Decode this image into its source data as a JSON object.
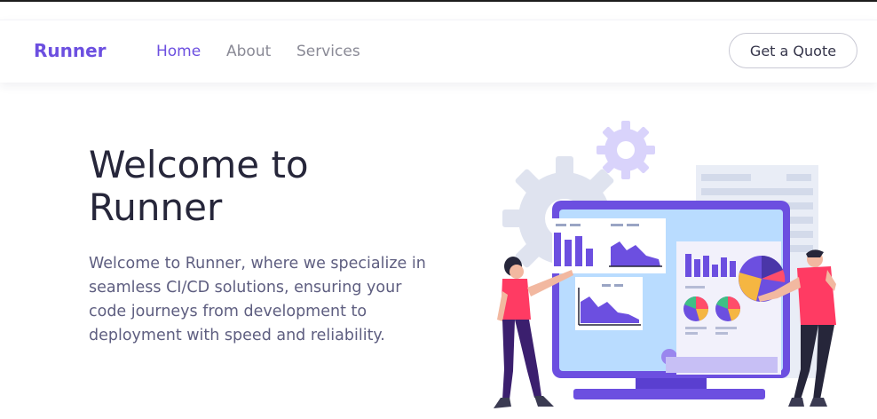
{
  "nav": {
    "brand": "Runner",
    "links": [
      "Home",
      "About",
      "Services"
    ],
    "active": "Home",
    "cta": "Get a Quote"
  },
  "hero": {
    "title": "Welcome to Runner",
    "description": "Welcome to Runner, where we specialize in seamless CI/CD solutions, ensuring your code journeys from development to deployment with speed and reliability."
  },
  "colors": {
    "brand": "#6c4fe0",
    "text_dark": "#26263a",
    "text_muted": "#5e5e80",
    "nav_inactive": "#8a8a96"
  },
  "illustration": {
    "icons": [
      "gear-icon",
      "monitor-dashboard",
      "bar-chart",
      "area-chart",
      "pie-chart",
      "person-woman",
      "person-man"
    ]
  }
}
